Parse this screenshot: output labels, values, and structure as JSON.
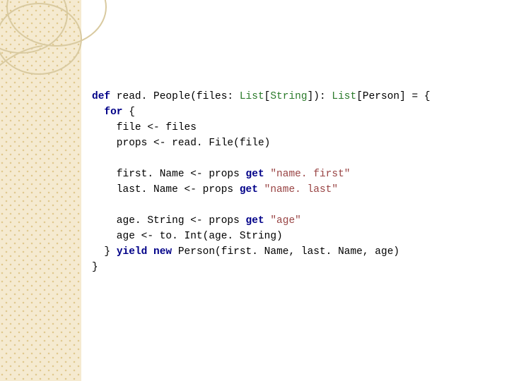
{
  "code": {
    "l1a": "def",
    "l1b": " read. People(files: ",
    "l1c": "List",
    "l1d": "[",
    "l1e": "String",
    "l1f": "]): ",
    "l1g": "List",
    "l1h": "[Person] = {",
    "l2a": "  for",
    "l2b": " {",
    "l3": "    file <- files",
    "l4": "    props <- read. File(file)",
    "blank1": "",
    "l5a": "    first. Name <- props ",
    "l5b": "get",
    "l5c": " ",
    "l5d": "\"name. first\"",
    "l6a": "    last. Name <- props ",
    "l6b": "get",
    "l6c": " ",
    "l6d": "\"name. last\"",
    "blank2": "",
    "l7a": "    age. String <- props ",
    "l7b": "get",
    "l7c": " ",
    "l7d": "\"age\"",
    "l8": "    age <- to. Int(age. String)",
    "l9a": "  } ",
    "l9b": "yield",
    "l9c": " ",
    "l9d": "new",
    "l9e": " Person(first. Name, last. Name, age)",
    "l10": "}"
  }
}
